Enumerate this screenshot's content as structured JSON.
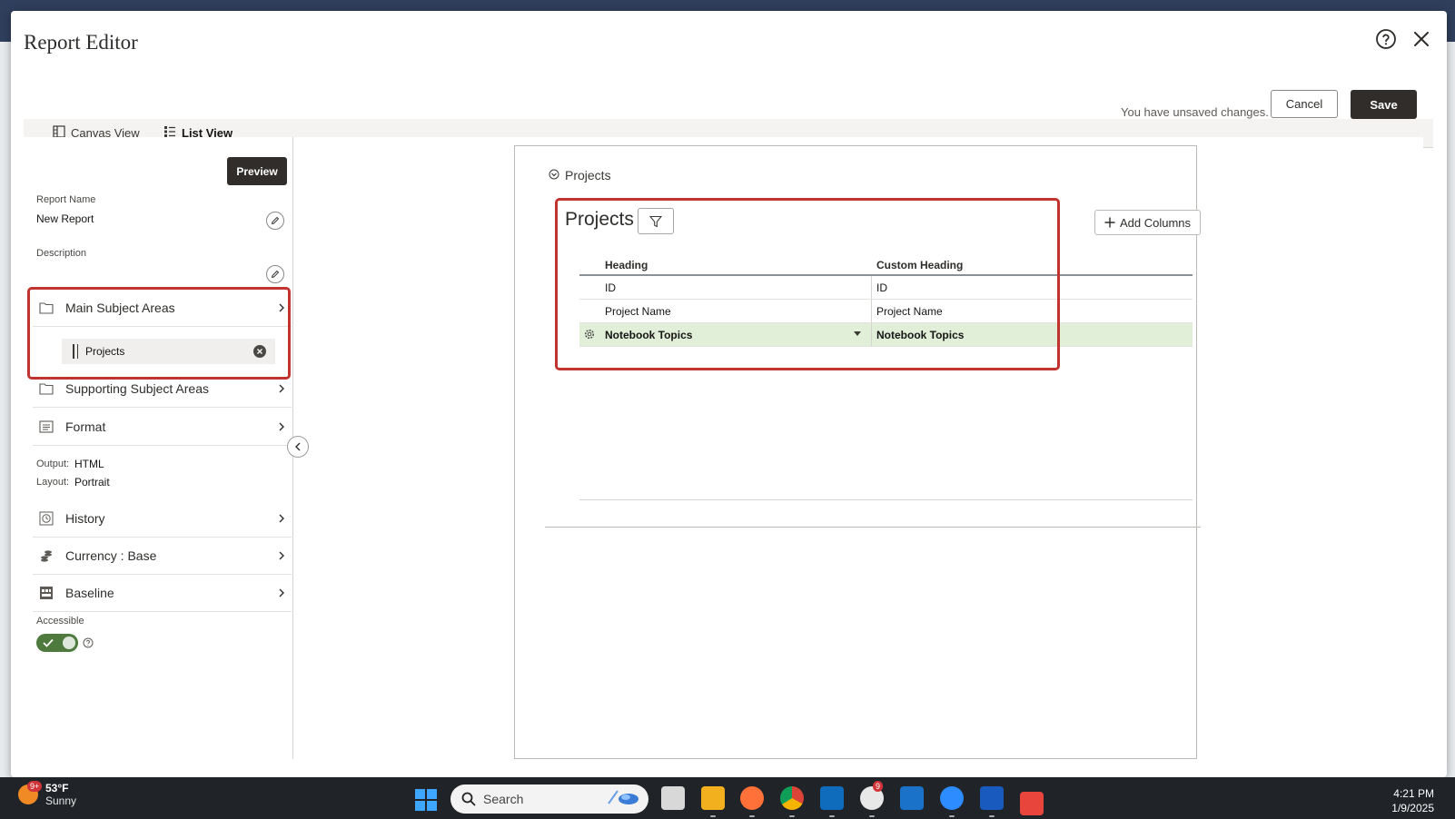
{
  "modal": {
    "title": "Report Editor",
    "unsaved_text": "You have unsaved changes.",
    "cancel_label": "Cancel",
    "save_label": "Save"
  },
  "tabs": [
    {
      "label": "Canvas View",
      "icon": "canvas-view-icon",
      "active": false
    },
    {
      "label": "List View",
      "icon": "list-view-icon",
      "active": true
    }
  ],
  "left_panel": {
    "preview_label": "Preview",
    "report_name_label": "Report Name",
    "report_name_value": "New Report",
    "description_label": "Description",
    "main_subject_areas": "Main Subject Areas",
    "project_chip": "Projects",
    "supporting_subject_areas": "Supporting Subject Areas",
    "format": "Format",
    "output_label": "Output:",
    "output_value": "HTML",
    "layout_label": "Layout:",
    "layout_value": "Portrait",
    "history": "History",
    "currency": "Currency : Base",
    "baseline": "Baseline",
    "accessible_label": "Accessible",
    "accessible_on": true
  },
  "canvas": {
    "section_title": "Projects",
    "table_title": "Projects",
    "add_columns_label": "Add Columns",
    "columns": [
      "Heading",
      "Custom Heading"
    ],
    "rows": [
      {
        "heading": "ID",
        "custom": "ID",
        "selected": false
      },
      {
        "heading": "Project Name",
        "custom": "Project Name",
        "selected": false
      },
      {
        "heading": "Notebook Topics",
        "custom": "Notebook Topics",
        "selected": true
      }
    ]
  },
  "taskbar": {
    "weather_badge": "9+",
    "temperature": "53°F",
    "condition": "Sunny",
    "search_placeholder": "Search",
    "time": "4:21 PM",
    "date": "1/9/2025",
    "slack_badge": "9"
  },
  "colors": {
    "accent_dark": "#312d2a",
    "highlight_red": "#c0332e",
    "selected_row": "#e1efd9",
    "toggle_on": "#4f7a3d"
  }
}
